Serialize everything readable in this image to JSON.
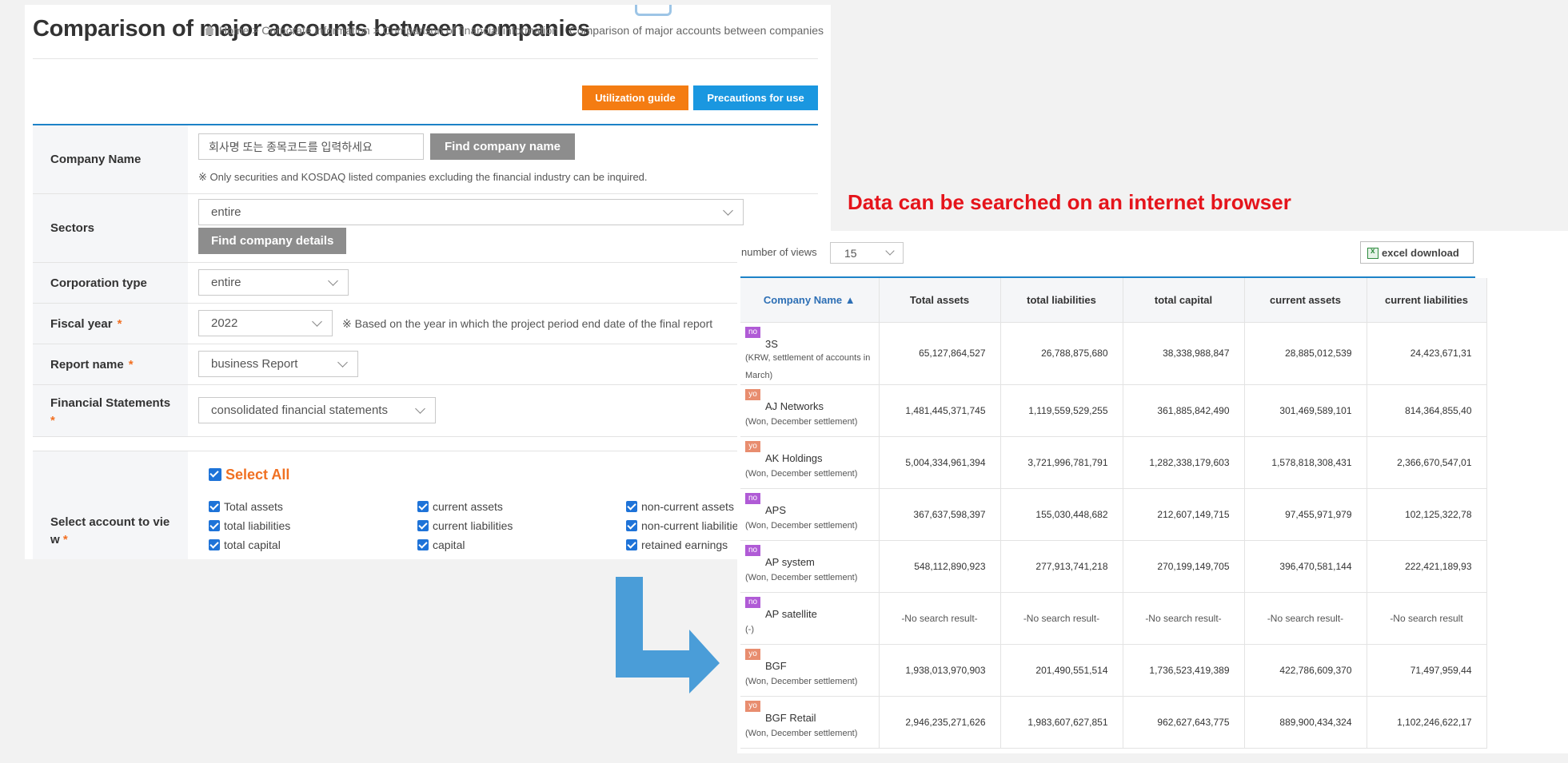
{
  "form": {
    "title": "Comparison of major accounts between companies",
    "breadcrumb_trail": "Home > Corporate information > Comparison of financial information",
    "breadcrumb_last": "Comparison of major accounts between companies",
    "guide_label": "Utilization guide",
    "precautions_label": "Precautions for use",
    "company_name": {
      "label": "Company Name",
      "placeholder": "회사명 또는 종목코드를 입력하세요",
      "button": "Find company name",
      "note": "※ Only securities and KOSDAQ listed companies excluding the financial industry can be inquired."
    },
    "sectors": {
      "label": "Sectors",
      "value": "entire",
      "button": "Find company details"
    },
    "corporation_type": {
      "label": "Corporation type",
      "value": "entire"
    },
    "fiscal_year": {
      "label": "Fiscal year",
      "required_mark": "*",
      "value": "2022",
      "note": "※ Based on the year in which the project period end date of the final report"
    },
    "report_name": {
      "label": "Report name",
      "required_mark": "*",
      "value": "business Report"
    },
    "financial_statements": {
      "label": "Financial Statements",
      "required_mark": "*",
      "value": "consolidated financial statements"
    },
    "select_account": {
      "label_line1": "Select account to vie",
      "label_line2": "w",
      "required_mark": "*",
      "select_all": "Select All",
      "accounts": [
        "Total assets",
        "current assets",
        "non-current assets",
        "total liabilities",
        "current liabilities",
        "non-current liabilities",
        "total capital",
        "capital",
        "retained earnings"
      ]
    }
  },
  "headline": "Data can be searched on an internet browser",
  "table": {
    "views_label": "number of views",
    "views_value": "15",
    "excel_label": "excel download",
    "headers": [
      "Company Name ▲",
      "Total assets",
      "total liabilities",
      "total capital",
      "current assets",
      "current liabilities"
    ],
    "rows": [
      {
        "badge": "no",
        "name": "3S",
        "sub": "(KRW, settlement of accounts in March)",
        "values": [
          "65,127,864,527",
          "26,788,875,680",
          "38,338,988,847",
          "28,885,012,539",
          "24,423,671,31"
        ]
      },
      {
        "badge": "yo",
        "name": "AJ Networks",
        "sub": "(Won, December settlement)",
        "values": [
          "1,481,445,371,745",
          "1,119,559,529,255",
          "361,885,842,490",
          "301,469,589,101",
          "814,364,855,40"
        ]
      },
      {
        "badge": "yo",
        "name": "AK Holdings",
        "sub": "(Won, December settlement)",
        "values": [
          "5,004,334,961,394",
          "3,721,996,781,791",
          "1,282,338,179,603",
          "1,578,818,308,431",
          "2,366,670,547,01"
        ]
      },
      {
        "badge": "no",
        "name": "APS",
        "sub": "(Won, December settlement)",
        "values": [
          "367,637,598,397",
          "155,030,448,682",
          "212,607,149,715",
          "97,455,971,979",
          "102,125,322,78"
        ]
      },
      {
        "badge": "no",
        "name": "AP system",
        "sub": "(Won, December settlement)",
        "values": [
          "548,112,890,923",
          "277,913,741,218",
          "270,199,149,705",
          "396,470,581,144",
          "222,421,189,93"
        ]
      },
      {
        "badge": "no",
        "name": "AP satellite",
        "sub": "(-)",
        "values": [
          "-No search result-",
          "-No search result-",
          "-No search result-",
          "-No search result-",
          "-No search result"
        ]
      },
      {
        "badge": "yo",
        "name": "BGF",
        "sub": "(Won, December settlement)",
        "values": [
          "1,938,013,970,903",
          "201,490,551,514",
          "1,736,523,419,389",
          "422,786,609,370",
          "71,497,959,44"
        ]
      },
      {
        "badge": "yo",
        "name": "BGF Retail",
        "sub": "(Won, December settlement)",
        "values": [
          "2,946,235,271,626",
          "1,983,607,627,851",
          "962,627,643,775",
          "889,900,434,324",
          "1,102,246,622,17"
        ]
      }
    ]
  },
  "colors": {
    "accent_blue": "#1a97e0",
    "accent_orange": "#f47c12",
    "headline_red": "#e5141b",
    "arrow_blue": "#4a9dd8"
  }
}
